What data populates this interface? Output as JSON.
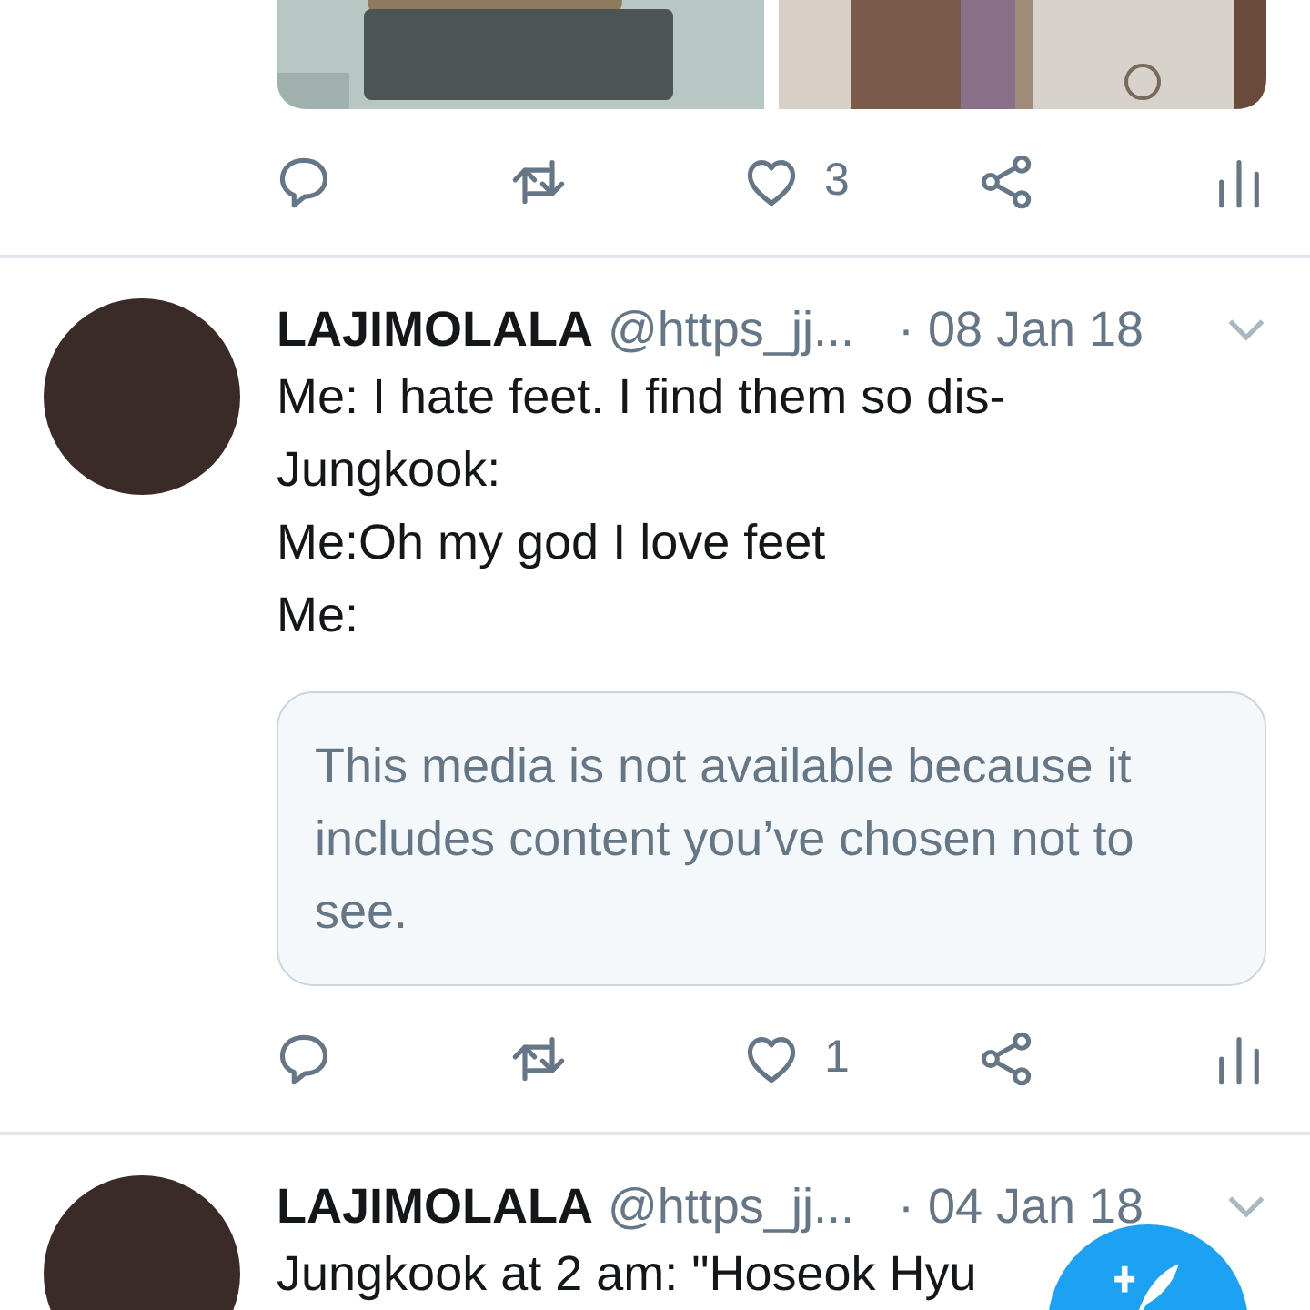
{
  "tweets": [
    {
      "actions": [
        {
          "kind": "reply"
        },
        {
          "kind": "retweet"
        },
        {
          "kind": "like",
          "count": "3"
        },
        {
          "kind": "share"
        },
        {
          "kind": "analytics"
        }
      ]
    },
    {
      "author": "LAJIMOLALA",
      "handle": "@https_jj...",
      "date": "· 08 Jan 18",
      "lines": [
        "Me: I hate feet. I find them so dis-",
        "Jungkook:",
        "Me:Oh my god I love feet",
        "Me:"
      ],
      "notice": "This media is not available because it includes content you’ve chosen not to see.",
      "actions": [
        {
          "kind": "reply"
        },
        {
          "kind": "retweet"
        },
        {
          "kind": "like",
          "count": "1"
        },
        {
          "kind": "share"
        },
        {
          "kind": "analytics"
        }
      ]
    },
    {
      "author": "LAJIMOLALA",
      "handle": "@https_jj...",
      "date": "· 04 Jan 18",
      "lines": [
        "Jungkook at 2 am: \"Hoseok Hyu"
      ]
    }
  ],
  "compose_button": {
    "kind": "compose"
  }
}
